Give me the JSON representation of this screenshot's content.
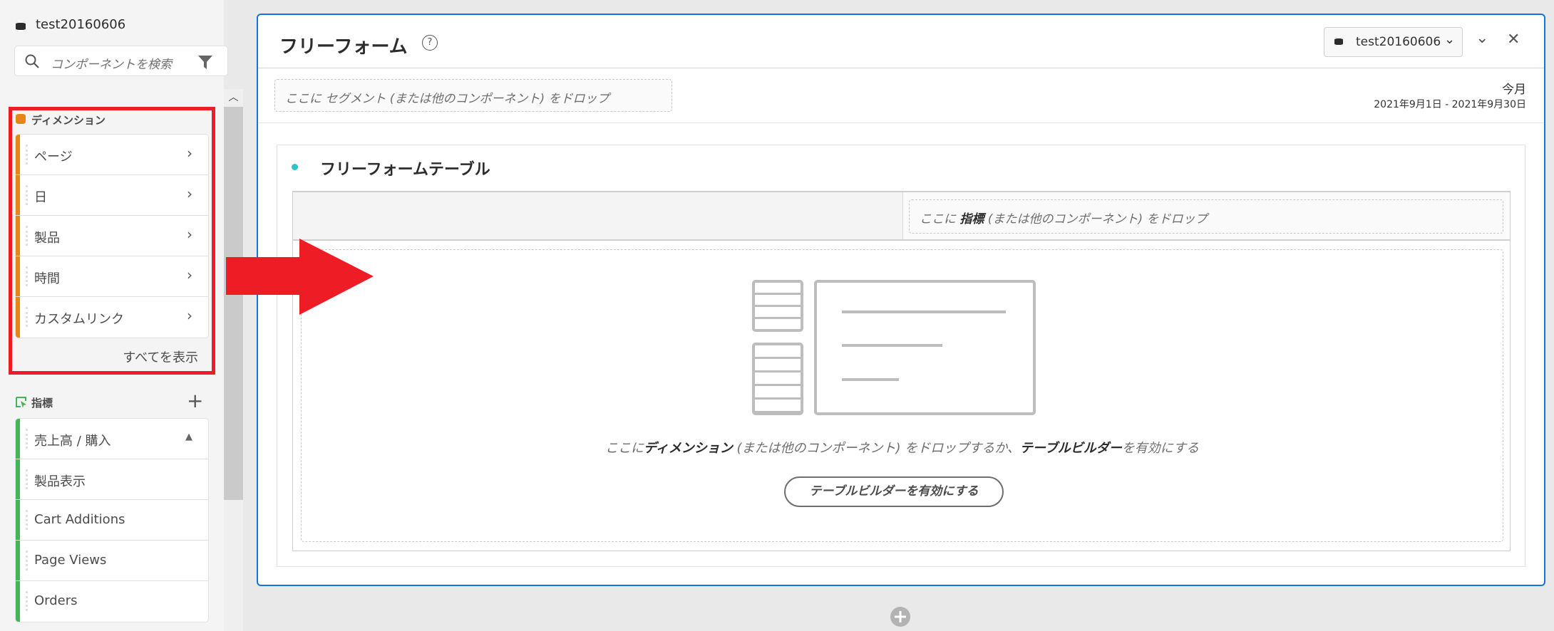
{
  "sidebar": {
    "report_suite": "test20160606",
    "search_placeholder": "コンポーネントを検索",
    "dimensions": {
      "title": "ディメンション",
      "items": [
        "ページ",
        "日",
        "製品",
        "時間",
        "カスタムリンク"
      ],
      "show_all": "すべてを表示",
      "color": "#e68619"
    },
    "metrics": {
      "title": "指標",
      "items": [
        "売上高 / 購入",
        "製品表示",
        "Cart Additions",
        "Page Views",
        "Orders"
      ],
      "color": "#44b556"
    }
  },
  "panel": {
    "title": "フリーフォーム",
    "help": "?",
    "report_suite": "test20160606",
    "segment_drop": "ここに セグメント (または他のコンポーネント) をドロップ",
    "date_label": "今月",
    "date_range": "2021年9月1日 - 2021年9月30日",
    "table": {
      "title": "フリーフォームテーブル",
      "metric_drop_prefix": "ここに ",
      "metric_drop_bold": "指標",
      "metric_drop_suffix": " (または他のコンポーネント) をドロップ",
      "body_prefix": "ここに",
      "body_bold1": "ディメンション",
      "body_mid": " (または他のコンポーネント) をドロップするか、",
      "body_bold2": "テーブルビルダー",
      "body_suffix": "を有効にする",
      "button": "テーブルビルダーを有効にする"
    }
  },
  "colors": {
    "accent": "#1473e6",
    "highlight": "#ee1c25"
  }
}
